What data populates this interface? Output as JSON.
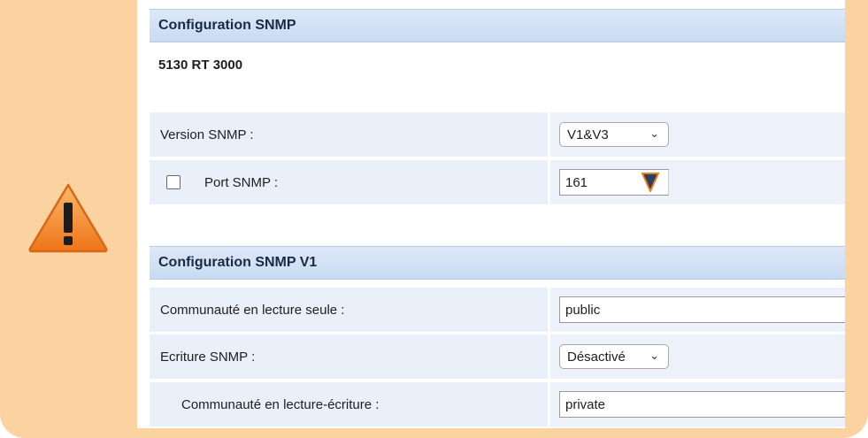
{
  "config_snmp": {
    "header": "Configuration SNMP",
    "device_name": "5130 RT 3000",
    "version_label": "Version SNMP :",
    "version_value": "V1&V3",
    "port_checked": false,
    "port_label": "Port SNMP :",
    "port_value": "161"
  },
  "config_snmp_v1": {
    "header": "Configuration SNMP V1",
    "read_community_label": "Communauté en lecture seule :",
    "read_community_value": "public",
    "write_label": "Ecriture SNMP :",
    "write_value": "Désactivé",
    "rw_community_label": "Communauté en lecture-écriture :",
    "rw_community_value": "private"
  },
  "icons": {
    "warning": "warning-triangle-icon",
    "dropdown": "chevron-down-icon"
  },
  "colors": {
    "frame": "#fbd3a1",
    "header_bg": "#c9dbf2",
    "row_bg": "#eaf0fa",
    "warning_orange": "#f07f1a"
  }
}
